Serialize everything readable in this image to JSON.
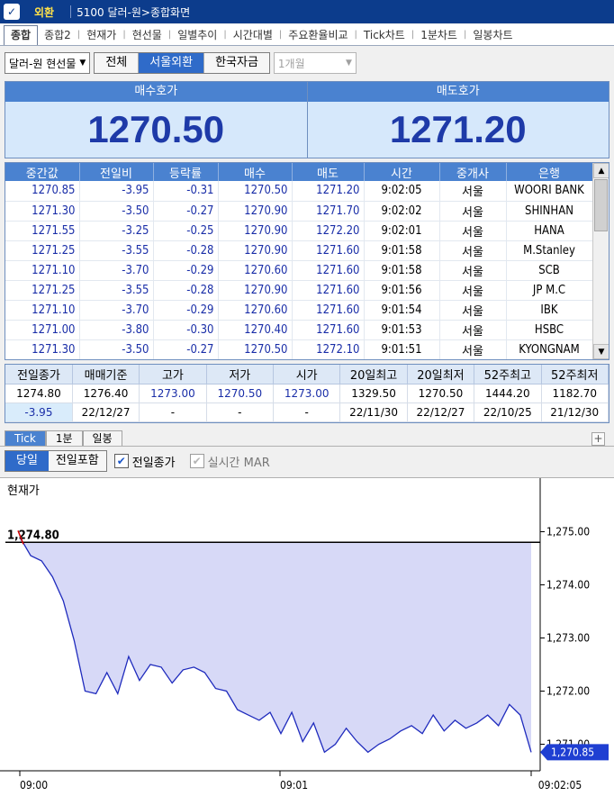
{
  "titlebar": {
    "badge": "외환",
    "title": "5100 달러-원>종합화면"
  },
  "tabs": [
    "종합",
    "종합2",
    "현재가",
    "현선물",
    "일별추이",
    "시간대별",
    "주요환율비교",
    "Tick차트",
    "1분차트",
    "일봉차트"
  ],
  "filters": {
    "instrument": "달러-원 현선물",
    "segments": [
      "전체",
      "서울외환",
      "한국자금"
    ],
    "segment_active": 1,
    "period": "1개월"
  },
  "quote": {
    "bid_label": "매수호가",
    "bid": "1270.50",
    "ask_label": "매도호가",
    "ask": "1271.20"
  },
  "ticks": {
    "headers": [
      "중간값",
      "전일비",
      "등락률",
      "매수",
      "매도",
      "시간",
      "중개사",
      "은행"
    ],
    "rows": [
      [
        "1270.85",
        "-3.95",
        "-0.31",
        "1270.50",
        "1271.20",
        "9:02:05",
        "서울",
        "WOORI BANK"
      ],
      [
        "1271.30",
        "-3.50",
        "-0.27",
        "1270.90",
        "1271.70",
        "9:02:02",
        "서울",
        "SHINHAN"
      ],
      [
        "1271.55",
        "-3.25",
        "-0.25",
        "1270.90",
        "1272.20",
        "9:02:01",
        "서울",
        "HANA"
      ],
      [
        "1271.25",
        "-3.55",
        "-0.28",
        "1270.90",
        "1271.60",
        "9:01:58",
        "서울",
        "M.Stanley"
      ],
      [
        "1271.10",
        "-3.70",
        "-0.29",
        "1270.60",
        "1271.60",
        "9:01:58",
        "서울",
        "SCB"
      ],
      [
        "1271.25",
        "-3.55",
        "-0.28",
        "1270.90",
        "1271.60",
        "9:01:56",
        "서울",
        "JP M.C"
      ],
      [
        "1271.10",
        "-3.70",
        "-0.29",
        "1270.60",
        "1271.60",
        "9:01:54",
        "서울",
        "IBK"
      ],
      [
        "1271.00",
        "-3.80",
        "-0.30",
        "1270.40",
        "1271.60",
        "9:01:53",
        "서울",
        "HSBC"
      ],
      [
        "1271.30",
        "-3.50",
        "-0.27",
        "1270.50",
        "1272.10",
        "9:01:51",
        "서울",
        "KYONGNAM"
      ]
    ]
  },
  "summary": {
    "headers": [
      "전일종가",
      "매매기준",
      "고가",
      "저가",
      "시가",
      "20일최고",
      "20일최저",
      "52주최고",
      "52주최저"
    ],
    "row1": [
      "1274.80",
      "1276.40",
      "1273.00",
      "1270.50",
      "1273.00",
      "1329.50",
      "1270.50",
      "1444.20",
      "1182.70"
    ],
    "row2": [
      "-3.95",
      "22/12/27",
      "-",
      "-",
      "-",
      "22/11/30",
      "22/12/27",
      "22/10/25",
      "21/12/30"
    ]
  },
  "chart_tabs": [
    "Tick",
    "1분",
    "일봉"
  ],
  "chart_options": {
    "seg": [
      "당일",
      "전일포함"
    ],
    "prev_close_label": "전일종가",
    "mar_label": "실시간 MAR"
  },
  "chart_data": {
    "type": "area",
    "title": "현재가",
    "prev_close": 1274.8,
    "prev_close_label": "1,274.80",
    "current_label": "1,270.85",
    "ylim": [
      1270.5,
      1275.5
    ],
    "yticks": [
      1275.0,
      1274.0,
      1273.0,
      1272.0,
      1271.0
    ],
    "ytick_labels": [
      "1,275.00",
      "1,274.00",
      "1,273.00",
      "1,272.00",
      "1,271.00"
    ],
    "xtick_labels": [
      "09:00",
      "09:01",
      "09:02:05"
    ],
    "values": [
      1274.9,
      1274.55,
      1274.45,
      1274.15,
      1273.7,
      1272.95,
      1272.0,
      1271.95,
      1272.35,
      1271.95,
      1272.65,
      1272.2,
      1272.5,
      1272.45,
      1272.15,
      1272.4,
      1272.45,
      1272.35,
      1272.05,
      1272.0,
      1271.65,
      1271.55,
      1271.45,
      1271.6,
      1271.2,
      1271.6,
      1271.05,
      1271.4,
      1270.85,
      1271.0,
      1271.3,
      1271.05,
      1270.85,
      1271.0,
      1271.1,
      1271.25,
      1271.35,
      1271.2,
      1271.55,
      1271.25,
      1271.45,
      1271.3,
      1271.4,
      1271.55,
      1271.35,
      1271.75,
      1271.55,
      1270.85
    ]
  }
}
